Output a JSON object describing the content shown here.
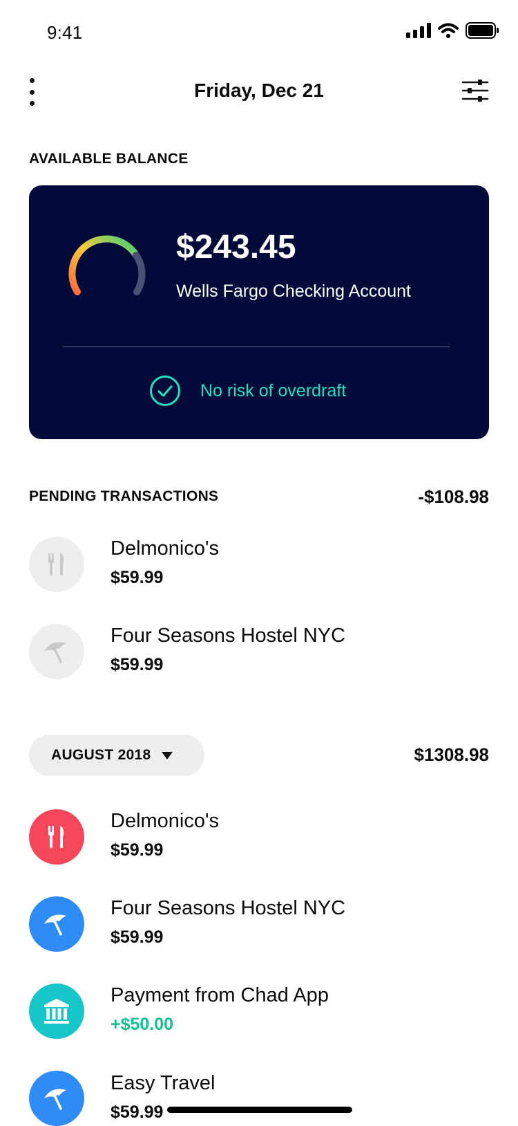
{
  "status_bar": {
    "time": "9:41"
  },
  "header": {
    "title": "Friday, Dec 21"
  },
  "balance": {
    "section_label": "AVAILABLE BALANCE",
    "amount": "$243.45",
    "account": "Wells Fargo Checking Account",
    "risk_text": "No risk of overdraft",
    "colors": {
      "card_bg": "#020a3a",
      "accent": "#1fe0c0"
    }
  },
  "pending": {
    "section_label": "PENDING TRANSACTIONS",
    "total": "-$108.98",
    "items": [
      {
        "name": "Delmonico's",
        "amount": "$59.99",
        "icon": "fork-knife-icon"
      },
      {
        "name": "Four Seasons Hostel NYC",
        "amount": "$59.99",
        "icon": "umbrella-icon"
      }
    ]
  },
  "month": {
    "label": "AUGUST 2018",
    "total": "$1308.98",
    "items": [
      {
        "name": "Delmonico's",
        "amount": "$59.99",
        "icon": "fork-knife-icon",
        "color": "#f5475b"
      },
      {
        "name": "Four Seasons Hostel NYC",
        "amount": "$59.99",
        "icon": "umbrella-icon",
        "color": "#2f8cf6"
      },
      {
        "name": "Payment from Chad App",
        "amount": "+$50.00",
        "icon": "bank-icon",
        "color": "#16c6c9"
      },
      {
        "name": "Easy Travel",
        "amount": "$59.99",
        "icon": "umbrella-icon",
        "color": "#2f8cf6"
      }
    ]
  }
}
